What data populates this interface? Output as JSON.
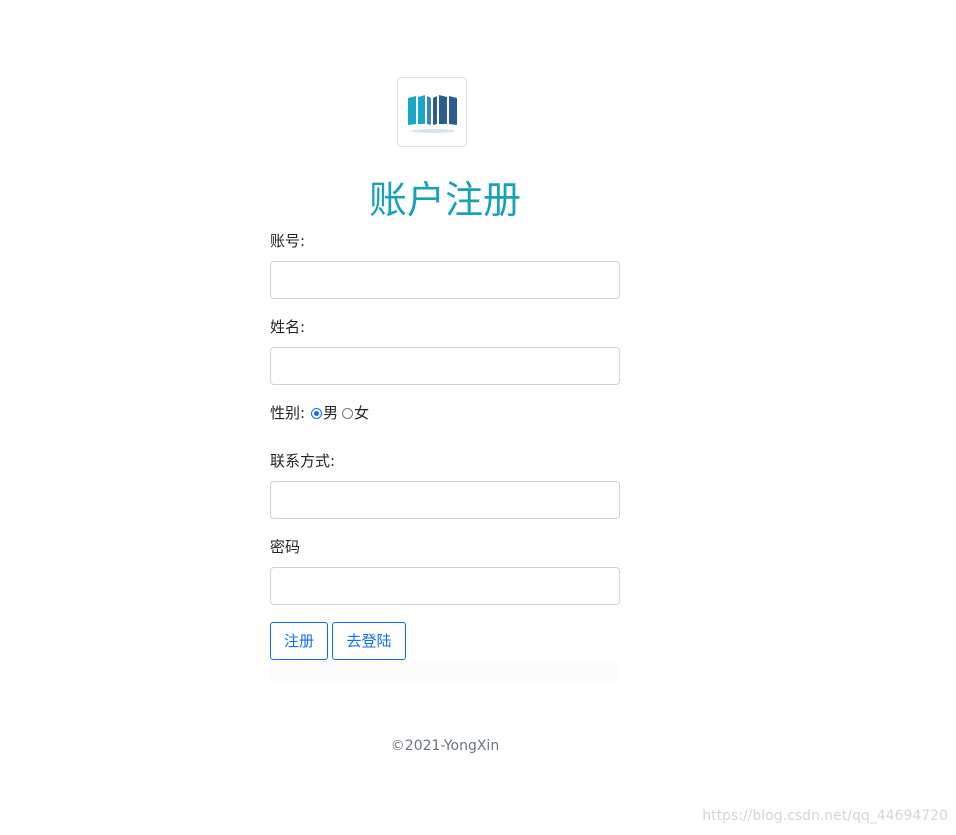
{
  "header": {
    "logo_icon": "open-book-icon",
    "title": "账户注册"
  },
  "form": {
    "account_label": "账号:",
    "account_value": "",
    "name_label": "姓名:",
    "name_value": "",
    "gender_label": "性别:",
    "gender_options": [
      {
        "label": "男",
        "checked": true
      },
      {
        "label": "女",
        "checked": false
      }
    ],
    "contact_label": "联系方式:",
    "contact_value": "",
    "password_label": "密码",
    "password_value": ""
  },
  "buttons": {
    "register": "注册",
    "go_login": "去登陆"
  },
  "footer": {
    "copyright": "©2021-YongXin"
  },
  "watermark": "https://blog.csdn.net/qq_44694720",
  "colors": {
    "title": "#17a2b8",
    "primary": "#0d6efd",
    "logo_teal": "#1aa6c8",
    "logo_dark": "#2a5d8f"
  }
}
